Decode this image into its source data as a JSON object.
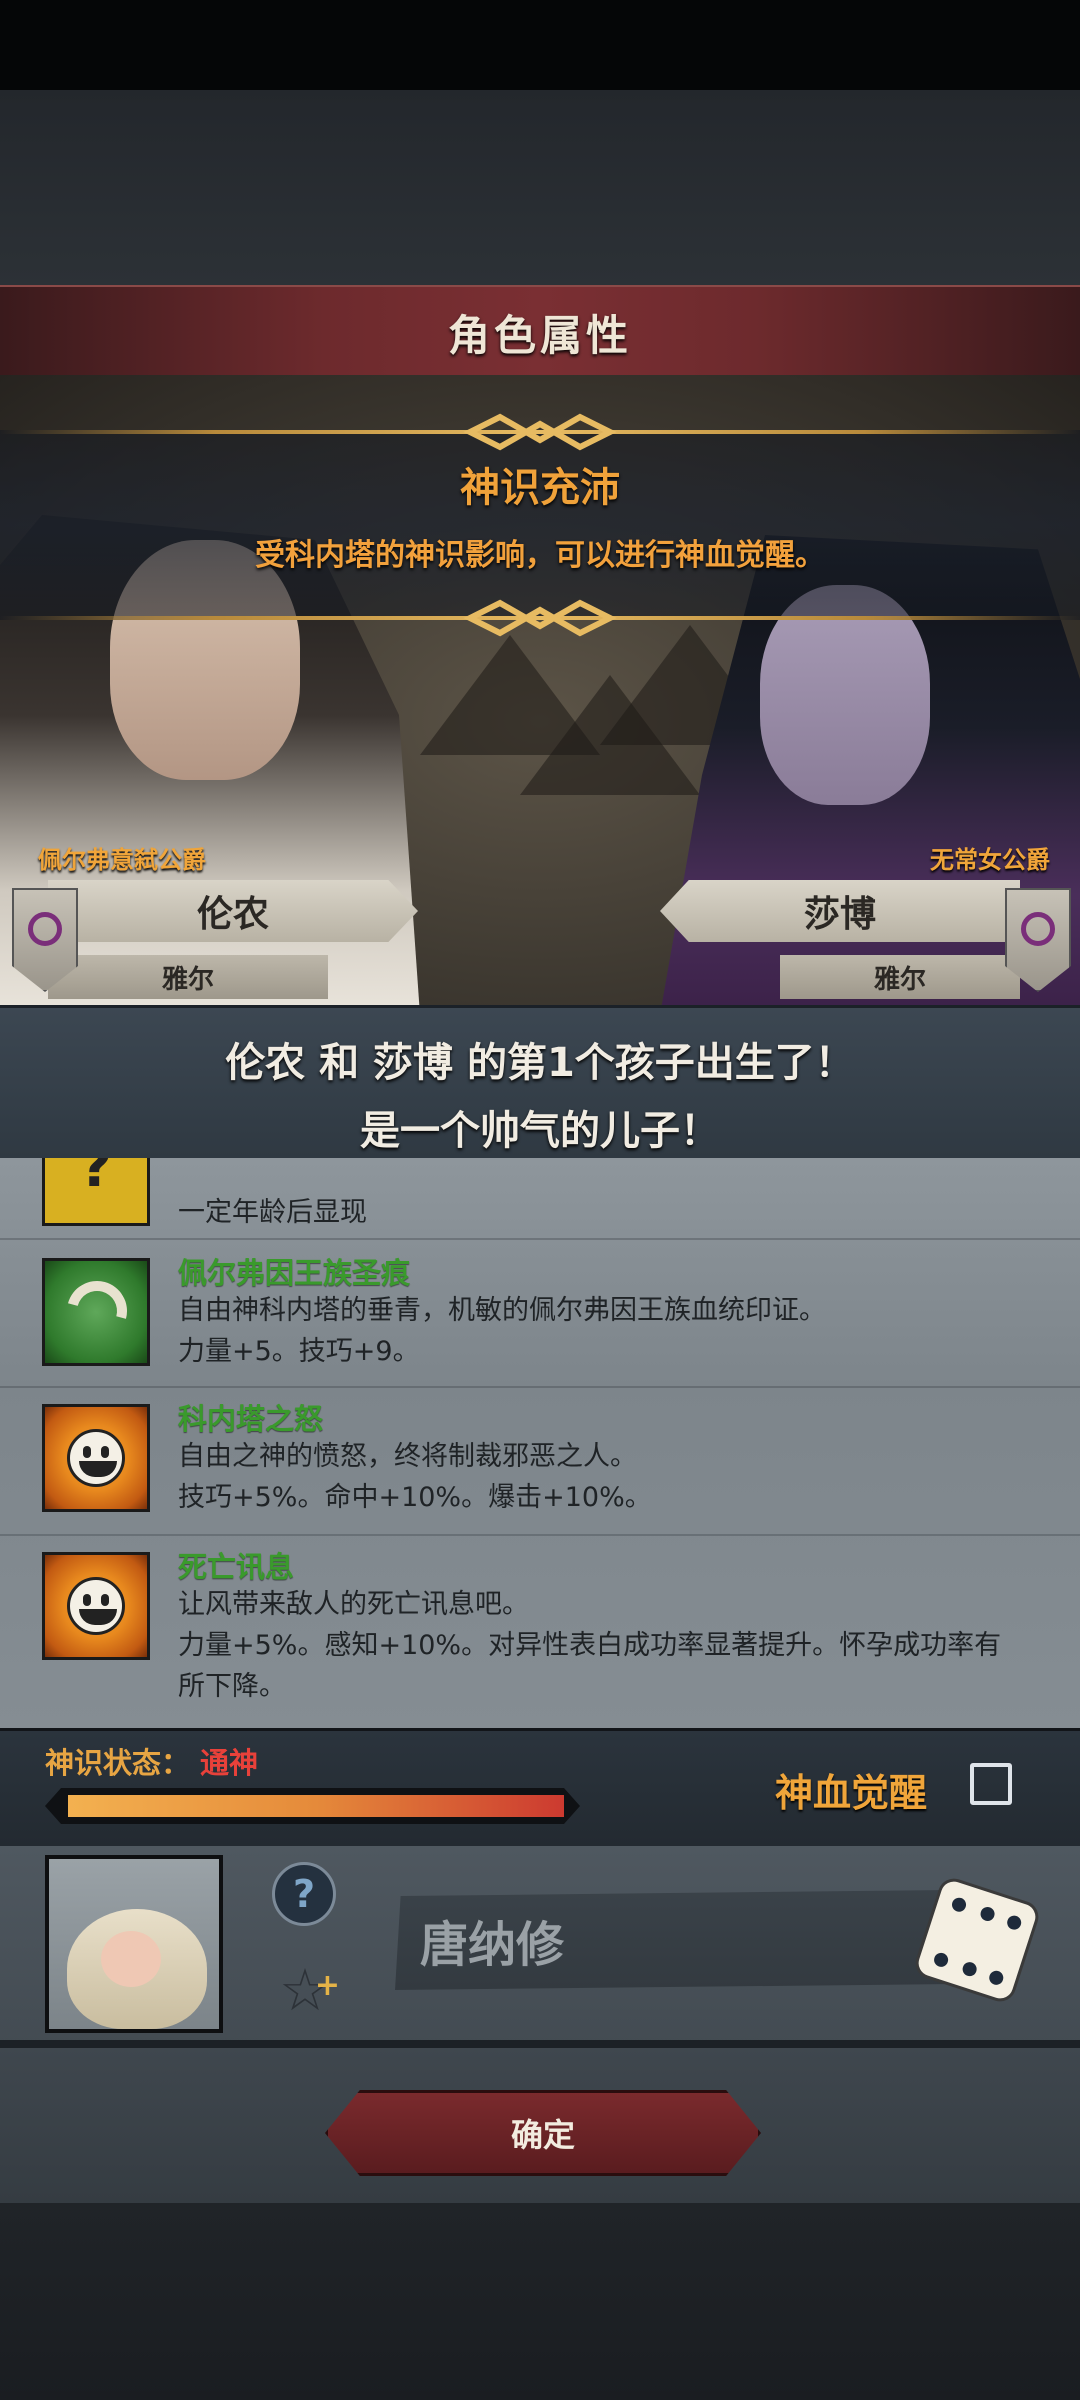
{
  "panel_title": "角色属性",
  "banner": {
    "title": "神识充沛",
    "subtitle": "受科内塔的神识影响，可以进行神血觉醒。"
  },
  "father": {
    "rank": "佩尔弗意弑公爵",
    "name": "伦农",
    "house": "雅尔"
  },
  "mother": {
    "rank": "无常女公爵",
    "name": "莎博",
    "house": "雅尔"
  },
  "message": {
    "line1": "伦农 和 莎博 的第1个孩子出生了！",
    "line2": "是一个帅气的儿子！"
  },
  "traits": [
    {
      "icon": "question-icon",
      "name": "",
      "lines": [
        "一定年龄后显现"
      ]
    },
    {
      "icon": "royal-crest-icon",
      "name": "佩尔弗因王族圣痕",
      "lines": [
        "自由神科内塔的垂青，机敏的佩尔弗因王族血统印证。",
        "力量+5。技巧+9。"
      ]
    },
    {
      "icon": "smiley-sun-icon",
      "name": "科内塔之怒",
      "lines": [
        "自由之神的愤怒，终将制裁邪恶之人。",
        "技巧+5%。命中+10%。爆击+10%。"
      ]
    },
    {
      "icon": "smiley-sun-icon",
      "name": "死亡讯息",
      "lines": [
        "让风带来敌人的死亡讯息吧。",
        "力量+5%。感知+10%。对异性表白成功率显著提升。怀孕成功率有",
        "所下降。"
      ]
    }
  ],
  "divine_status": {
    "label": "神识状态：",
    "value": "通神",
    "level": 1.0
  },
  "awaken": {
    "label": "神血觉醒",
    "checked": false
  },
  "child": {
    "name_value": "唐纳修"
  },
  "confirm_label": "确定",
  "colors": {
    "accent_orange": "#f0a53a",
    "trait_green": "#3a9a2c",
    "status_red": "#e8413a",
    "title_red": "#7a2f33"
  }
}
